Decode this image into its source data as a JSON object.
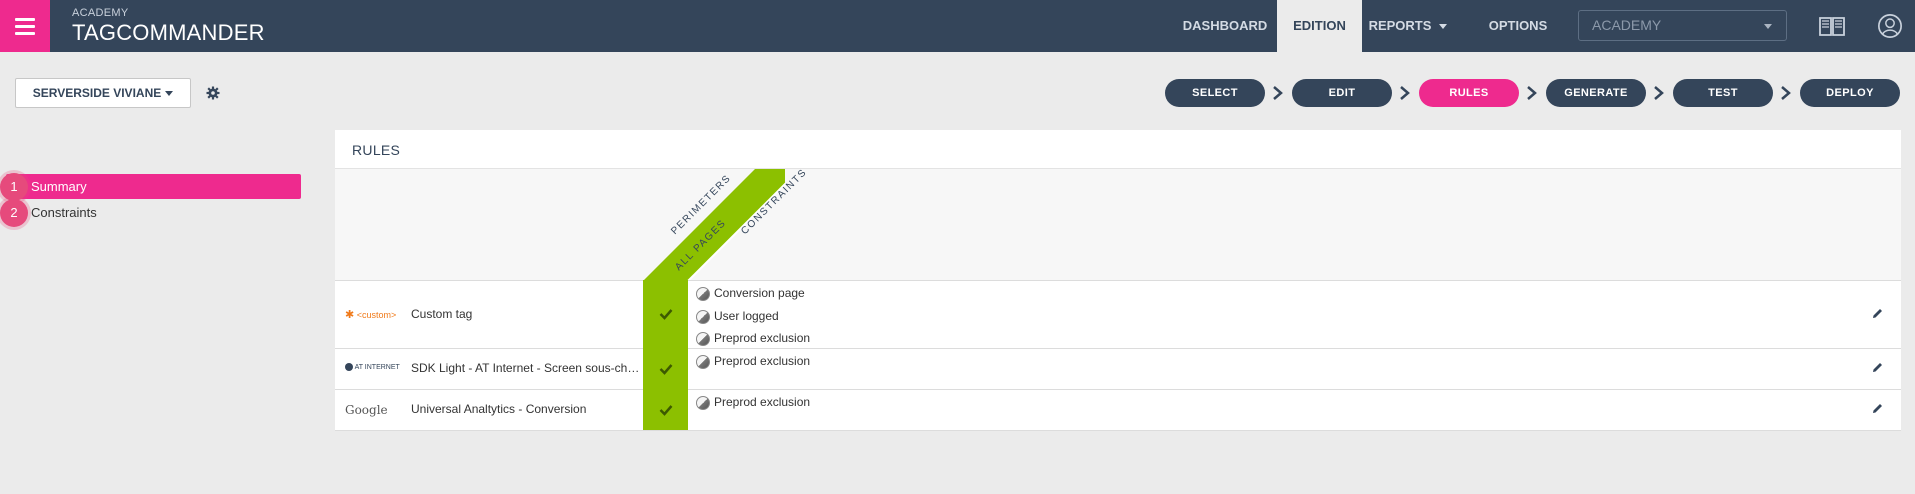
{
  "app": {
    "brand_small": "ACADEMY",
    "brand": "TAGCOMMANDER",
    "menu_icon": "hamburger-icon"
  },
  "nav": {
    "items": [
      {
        "label": "DASHBOARD"
      },
      {
        "label": "EDITION"
      },
      {
        "label": "REPORTS"
      },
      {
        "label": "OPTIONS"
      }
    ],
    "active": "EDITION",
    "site_select": {
      "value": "ACADEMY"
    },
    "icons": [
      "book-icon",
      "user-icon"
    ]
  },
  "toolbar": {
    "project_label": "SERVERSIDE VIVIANE",
    "settings_icon": "gear-icon"
  },
  "steps": {
    "items": [
      {
        "label": "SELECT"
      },
      {
        "label": "EDIT"
      },
      {
        "label": "RULES"
      },
      {
        "label": "GENERATE"
      },
      {
        "label": "TEST"
      },
      {
        "label": "DEPLOY"
      }
    ],
    "active": "RULES"
  },
  "sidebar": {
    "items": [
      {
        "num": "1",
        "label": "Summary",
        "active": true
      },
      {
        "num": "2",
        "label": "Constraints",
        "active": false
      }
    ]
  },
  "rules": {
    "title": "RULES",
    "headers": {
      "perimeters": "PERIMETERS",
      "all_pages": "ALL PAGES",
      "constraints": "CONSTRAINTS"
    },
    "rows": [
      {
        "logo": "<custom>",
        "name": "Custom tag",
        "all_pages": true,
        "constraints": [
          "Conversion page",
          "User logged",
          "Preprod exclusion"
        ]
      },
      {
        "logo": "AT INTERNET",
        "name": "SDK Light - AT Internet - Screen sous-chap...",
        "all_pages": true,
        "constraints": [
          "Preprod exclusion"
        ]
      },
      {
        "logo": "Google",
        "name": "Universal Analtytics - Conversion",
        "all_pages": true,
        "constraints": [
          "Preprod exclusion"
        ]
      }
    ]
  },
  "colors": {
    "topbar": "#34455a",
    "accent": "#ee2a8e",
    "green": "#8cc000",
    "background": "#ebebeb"
  }
}
